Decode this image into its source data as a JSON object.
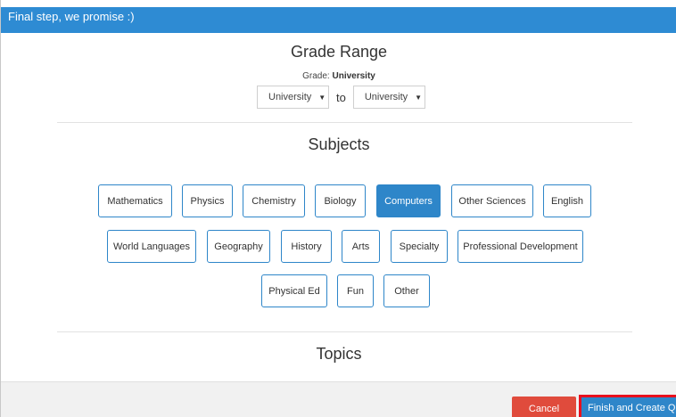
{
  "header": {
    "title": "Final step, we promise :)"
  },
  "grade_range": {
    "title": "Grade Range",
    "caption_prefix": "Grade:",
    "caption_value": "University",
    "from_value": "University",
    "to_label": "to",
    "to_value": "University"
  },
  "subjects": {
    "title": "Subjects",
    "items": [
      {
        "label": "Mathematics",
        "selected": false
      },
      {
        "label": "Physics",
        "selected": false
      },
      {
        "label": "Chemistry",
        "selected": false
      },
      {
        "label": "Biology",
        "selected": false
      },
      {
        "label": "Computers",
        "selected": true
      },
      {
        "label": "Other Sciences",
        "selected": false
      },
      {
        "label": "English",
        "selected": false
      },
      {
        "label": "World Languages",
        "selected": false
      },
      {
        "label": "Geography",
        "selected": false
      },
      {
        "label": "History",
        "selected": false
      },
      {
        "label": "Arts",
        "selected": false
      },
      {
        "label": "Specialty",
        "selected": false
      },
      {
        "label": "Professional Development",
        "selected": false
      },
      {
        "label": "Physical Ed",
        "selected": false
      },
      {
        "label": "Fun",
        "selected": false
      },
      {
        "label": "Other",
        "selected": false
      }
    ]
  },
  "topics": {
    "title": "Topics"
  },
  "footer": {
    "cancel_label": "Cancel",
    "finish_label": "Finish and Create Quiz"
  },
  "colors": {
    "header": "#2e8bd3",
    "chip_border": "#2e86c9",
    "chip_selected": "#2e86c9",
    "cancel": "#e04b3c",
    "highlight": "#e8101e"
  }
}
